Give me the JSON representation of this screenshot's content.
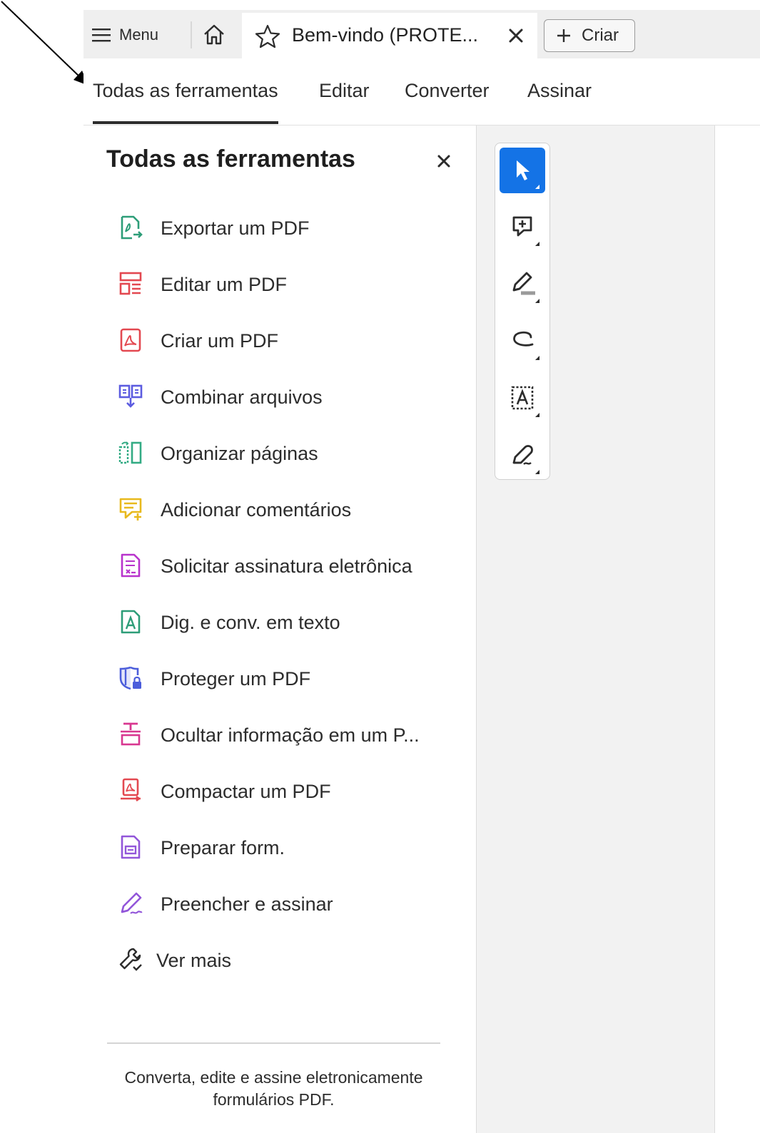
{
  "tabbar": {
    "menu_label": "Menu",
    "doc_tab_title": "Bem-vindo (PROTE...",
    "create_label": "Criar"
  },
  "navtabs": [
    {
      "label": "Todas as ferramentas",
      "active": true
    },
    {
      "label": "Editar",
      "active": false
    },
    {
      "label": "Converter",
      "active": false
    },
    {
      "label": "Assinar",
      "active": false
    }
  ],
  "panel": {
    "title": "Todas as ferramentas",
    "tools": [
      {
        "label": "Exportar um PDF",
        "icon": "export-pdf-icon",
        "color": "#2d9d78"
      },
      {
        "label": "Editar um PDF",
        "icon": "edit-pdf-icon",
        "color": "#e34850"
      },
      {
        "label": "Criar um PDF",
        "icon": "create-pdf-icon",
        "color": "#e34850"
      },
      {
        "label": "Combinar arquivos",
        "icon": "combine-files-icon",
        "color": "#5c5ce0"
      },
      {
        "label": "Organizar páginas",
        "icon": "organize-pages-icon",
        "color": "#33ab84"
      },
      {
        "label": "Adicionar comentários",
        "icon": "add-comment-icon",
        "color": "#e8b91d"
      },
      {
        "label": "Solicitar assinatura eletrônica",
        "icon": "request-signature-icon",
        "color": "#b833cc"
      },
      {
        "label": "Dig. e conv. em texto",
        "icon": "scan-ocr-icon",
        "color": "#2d9d78"
      },
      {
        "label": "Proteger um PDF",
        "icon": "protect-pdf-icon",
        "color": "#4b5ddb"
      },
      {
        "label": "Ocultar informação em um P...",
        "icon": "redact-icon",
        "color": "#d83790"
      },
      {
        "label": "Compactar um PDF",
        "icon": "compress-pdf-icon",
        "color": "#e34850"
      },
      {
        "label": "Preparar form.",
        "icon": "prepare-form-icon",
        "color": "#9256d9"
      },
      {
        "label": "Preencher e assinar",
        "icon": "fill-sign-icon",
        "color": "#9256d9"
      },
      {
        "label": "Ver mais",
        "icon": "wrench-more-icon",
        "color": "#2c2c2c"
      }
    ],
    "footer": "Converta, edite e assine eletronicamente formulários PDF."
  },
  "quick_toolbar": [
    {
      "icon": "select-cursor-icon",
      "selected": true
    },
    {
      "icon": "add-comment-icon",
      "selected": false
    },
    {
      "icon": "highlight-pen-icon",
      "selected": false
    },
    {
      "icon": "draw-freehand-icon",
      "selected": false
    },
    {
      "icon": "text-recognition-icon",
      "selected": false
    },
    {
      "icon": "sign-pen-icon",
      "selected": false
    }
  ],
  "colors": {
    "accent": "#1473e6",
    "tab_strip": "#efefef",
    "viewer_bg": "#f2f2f2"
  }
}
